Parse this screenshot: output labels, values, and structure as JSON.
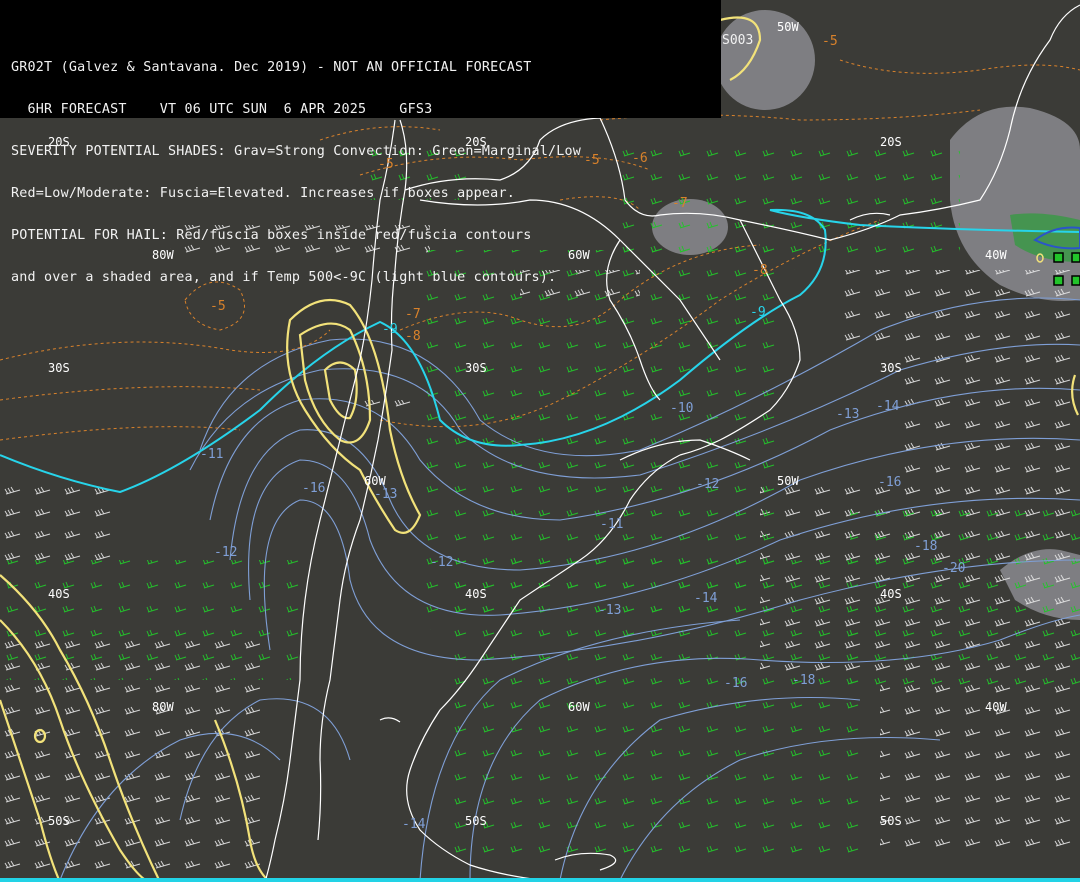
{
  "header": {
    "lines": [
      "GR02T (Galvez & Santavana. Dec 2019) - NOT AN OFFICIAL FORECAST",
      "  6HR FORECAST    VT 06 UTC SUN  6 APR 2025    GFS3",
      "SEVERITY POTENTIAL SHADES: Grav=Strong Convection: Green=Marginal/Low",
      "Red=Low/Moderate: Fuscia=Elevated. Increases if boxes appear.",
      "POTENTIAL FOR HAIL: Red/fuscia boxes inside red/fuscia contours",
      "and over a shaded area, and if Temp 500<-9C (light blue contours)."
    ],
    "top_right_label": "S003"
  },
  "grid_labels": {
    "lat": [
      "20S",
      "30S",
      "40S",
      "50S"
    ],
    "lon": [
      "80W",
      "60W",
      "50W",
      "40W"
    ]
  },
  "orange_labels": [
    "-5",
    "-5",
    "-6",
    "-5",
    "-7",
    "-8",
    "-8",
    "-5",
    "-7"
  ],
  "cyan_labels": [
    "-9",
    "-9"
  ],
  "blue_labels": [
    "-11",
    "-12",
    "-13",
    "-14",
    "-16",
    "-18",
    "-20",
    "-10",
    "-12",
    "-13",
    "-11",
    "-12",
    "-14",
    "-16",
    "-18",
    "-13",
    "-14",
    "-16",
    "-18",
    "-12",
    "-16"
  ],
  "colors": {
    "background": "#3b3b37",
    "coast": "#ffffff",
    "temp_500_blue": "#7f9fd6",
    "temp_850_orange": "#d9822b",
    "minus9_cyan": "#27d4ea",
    "severity_yellow": "#f2e27a",
    "wind_green": "#22c42a",
    "wind_white": "#e8e8e8",
    "gray_shade": "#8b8b8f",
    "alert_box": "#1f6f3a"
  }
}
